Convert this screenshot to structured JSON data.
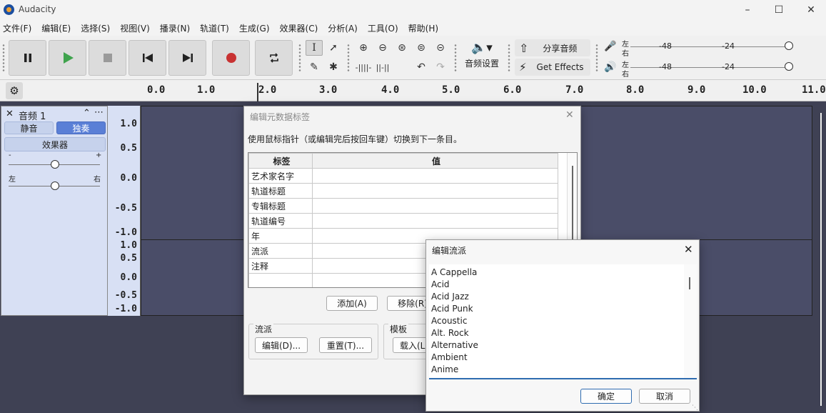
{
  "app": {
    "title": "Audacity"
  },
  "menu": [
    "文件(F)",
    "编辑(E)",
    "选择(S)",
    "视图(V)",
    "播录(N)",
    "轨道(T)",
    "生成(G)",
    "效果器(C)",
    "分析(A)",
    "工具(O)",
    "帮助(H)"
  ],
  "toolbar": {
    "audio_setup_label": "音频设置",
    "share_label": "分享音频",
    "get_effects_label": "Get Effects",
    "meter_left": "左",
    "meter_right": "右",
    "meter_ticks": [
      "-48",
      "-24"
    ]
  },
  "ruler": {
    "ticks": [
      "0.0",
      "1.0",
      "2.0",
      "3.0",
      "4.0",
      "5.0",
      "6.0",
      "7.0",
      "8.0",
      "9.0",
      "10.0",
      "11.0"
    ]
  },
  "track": {
    "name": "音频 1",
    "mute_label": "静音",
    "solo_label": "独奏",
    "effects_label": "效果器",
    "pan_left": "左",
    "pan_right": "右",
    "gain_minus": "-",
    "gain_plus": "+",
    "scale_upper": [
      "1.0",
      "0.5",
      "0.0",
      "-0.5",
      "-1.0"
    ],
    "scale_lower": [
      "1.0",
      "0.5",
      "0.0",
      "-0.5",
      "-1.0"
    ]
  },
  "metadata_dialog": {
    "title": "编辑元数据标签",
    "instruction": "使用鼠标指针（或编辑完后按回车键）切换到下一条目。",
    "col_tag": "标签",
    "col_value": "值",
    "rows": [
      "艺术家名字",
      "轨道标题",
      "专辑标题",
      "轨道编号",
      "年",
      "流派",
      "注释",
      ""
    ],
    "add_label": "添加(A)",
    "remove_label": "移除(R)",
    "genre_group": "流派",
    "template_group": "模板",
    "edit_label": "编辑(D)...",
    "reset_label": "重置(T)...",
    "load_label": "载入(L)"
  },
  "genre_dialog": {
    "title": "编辑流派",
    "genres": [
      "A Cappella",
      "Acid",
      "Acid Jazz",
      "Acid Punk",
      "Acoustic",
      "Alt. Rock",
      "Alternative",
      "Ambient",
      "Anime"
    ],
    "ok_label": "确定",
    "cancel_label": "取消"
  },
  "colors": {
    "track_bg": "#4a4d68",
    "panel_bg": "#d8e0f4",
    "solo_active": "#5a7fd6",
    "record": "#c83232",
    "play": "#3fa34d"
  }
}
